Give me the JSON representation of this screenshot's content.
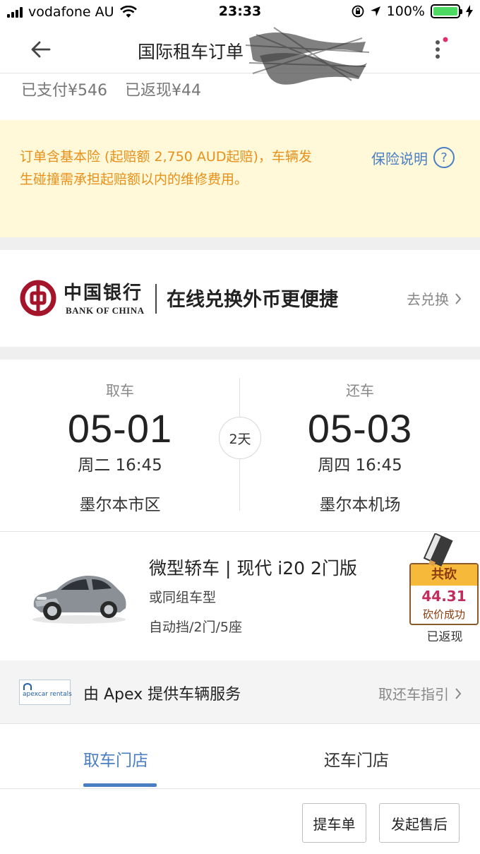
{
  "status_bar": {
    "carrier": "vodafone AU",
    "time": "23:33",
    "battery": "100%"
  },
  "nav": {
    "title": "国际租车订单"
  },
  "payment": {
    "paid": "已支付¥546",
    "cashback": "已返现¥44"
  },
  "insurance": {
    "notice": "订单含基本险 (起赔额 2,750 AUD起赔)，车辆发生碰撞需承担起赔额以内的维修费用。",
    "link": "保险说明",
    "help_glyph": "?"
  },
  "bank_banner": {
    "logo_cn": "中国银行",
    "logo_en": "BANK OF CHINA",
    "slogan": "在线兑换外币更便捷",
    "action": "去兑换"
  },
  "rental": {
    "pickup": {
      "label": "取车",
      "date": "05-01",
      "time": "周二 16:45",
      "location": "墨尔本市区"
    },
    "dropoff": {
      "label": "还车",
      "date": "05-03",
      "time": "周四 16:45",
      "location": "墨尔本机场"
    },
    "duration": "2天"
  },
  "car": {
    "title": "微型轿车 | 现代 i20 2门版",
    "similar": "或同组车型",
    "specs": "自动挡/2门/5座"
  },
  "bargain_badge": {
    "header": "共砍",
    "amount": "44.31",
    "status": "砍价成功",
    "returned": "已返现"
  },
  "provider": {
    "logo_text": "apexcar rentals",
    "text": "由 Apex 提供车辆服务",
    "guide": "取还车指引"
  },
  "tabs": [
    {
      "label": "取车门店",
      "active": true
    },
    {
      "label": "还车门店",
      "active": false
    }
  ],
  "buttons": {
    "pickup_form": "提车单",
    "after_sales": "发起售后"
  },
  "colors": {
    "accent_blue": "#4a7fc4",
    "warning_orange": "#e8901a",
    "warning_bg": "#fff8d9",
    "boc_red": "#a4152b",
    "badge_pink": "#c22d5d"
  }
}
